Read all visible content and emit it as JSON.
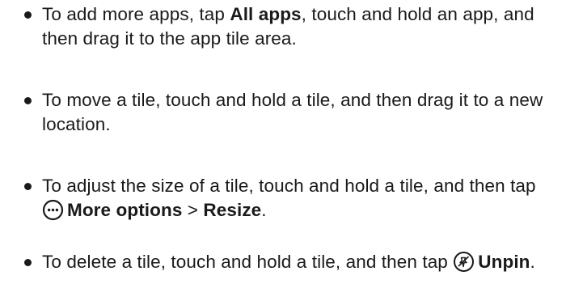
{
  "items": [
    {
      "pre": "To add more apps, tap ",
      "bold1": "All apps",
      "post": ", touch and hold an app, and then drag it to the app tile area."
    },
    {
      "text": "To move a tile, touch and hold a tile, and then drag it to a new location."
    },
    {
      "pre": "To adjust the size of a tile, touch and hold a tile, and then tap ",
      "bold1": "More options",
      "sep": " > ",
      "bold2": "Resize",
      "post": ".",
      "icon": "more-options-icon"
    },
    {
      "pre": "To delete a tile, touch and hold a tile, and then tap ",
      "bold1": "Unpin",
      "post": ".",
      "icon": "unpin-icon"
    }
  ]
}
